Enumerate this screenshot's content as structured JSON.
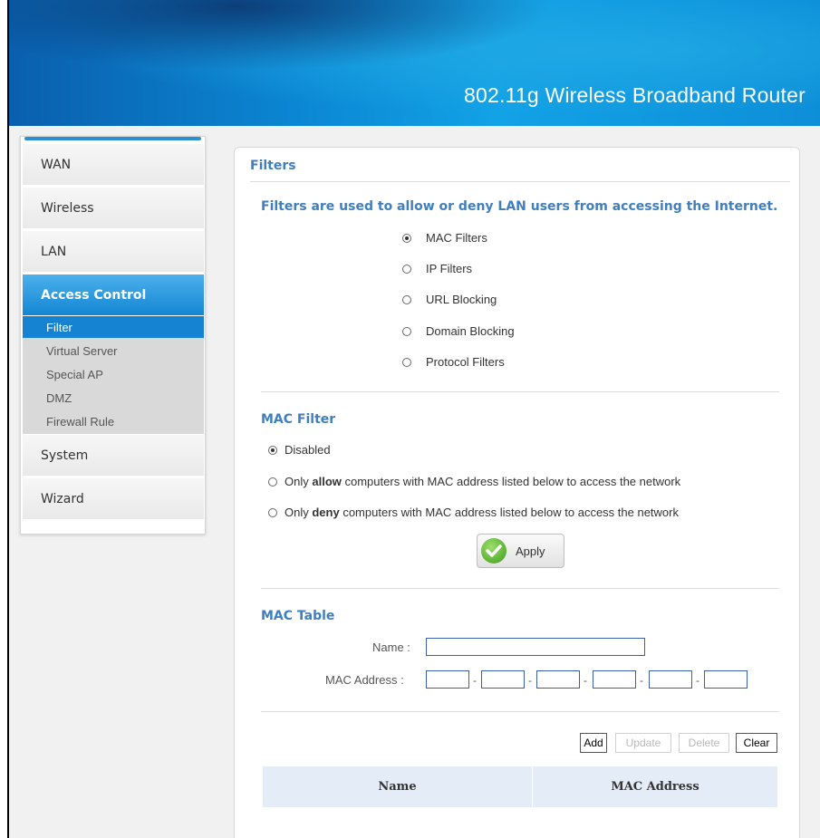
{
  "header": {
    "title": "802.11g Wireless Broadband Router"
  },
  "sidebar": {
    "items": [
      {
        "label": "WAN"
      },
      {
        "label": "Wireless"
      },
      {
        "label": "LAN"
      },
      {
        "label": "Access Control",
        "active": true
      },
      {
        "label": "System"
      },
      {
        "label": "Wizard"
      }
    ],
    "sub_items": [
      {
        "label": "Filter",
        "active": true
      },
      {
        "label": "Virtual Server"
      },
      {
        "label": "Special AP"
      },
      {
        "label": "DMZ"
      },
      {
        "label": "Firewall Rule"
      }
    ]
  },
  "filters": {
    "title": "Filters",
    "description": "Filters are used to allow or deny LAN users from accessing the Internet.",
    "options": [
      {
        "label": "MAC Filters",
        "checked": true
      },
      {
        "label": "IP Filters",
        "checked": false
      },
      {
        "label": "URL Blocking",
        "checked": false
      },
      {
        "label": "Domain Blocking",
        "checked": false
      },
      {
        "label": "Protocol Filters",
        "checked": false
      }
    ]
  },
  "mac_filter": {
    "title": "MAC Filter",
    "disabled_label": "Disabled",
    "selected": "Disabled",
    "allow_prefix": "Only",
    "allow_bold": "allow",
    "allow_suffix": "computers with MAC address listed below to access the network",
    "deny_prefix": "Only",
    "deny_bold": "deny",
    "deny_suffix": "computers with MAC address listed below to access the network",
    "apply_label": "Apply"
  },
  "mac_table": {
    "title": "MAC Table",
    "name_label": "Name :",
    "name_value": "",
    "mac_label": "MAC Address :",
    "mac_values": [
      "",
      "",
      "",
      "",
      "",
      ""
    ],
    "separator": "-",
    "buttons": {
      "add": "Add",
      "update": "Update",
      "delete": "Delete",
      "clear": "Clear"
    },
    "columns": [
      "Name",
      "MAC Address"
    ],
    "rows": []
  },
  "colors": {
    "accent": "#3f7fbf",
    "nav_active": "#1583d1",
    "table_header": "#e4edf7"
  }
}
